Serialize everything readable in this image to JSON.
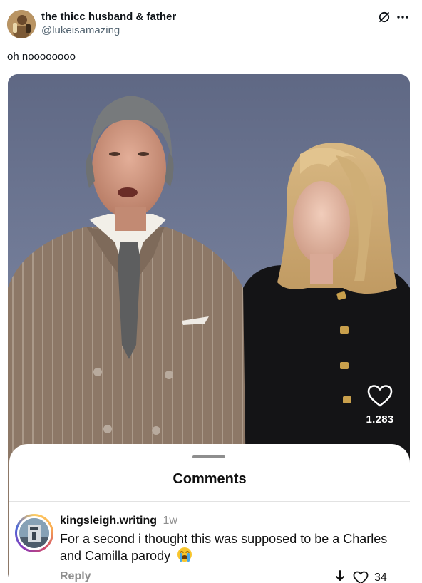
{
  "tweet": {
    "display_name": "the thicc husband & father",
    "handle": "@lukeisamazing",
    "text": "oh noooooooo",
    "icons": [
      "grok-icon",
      "more-icon"
    ]
  },
  "video": {
    "like_icon": "heart-outline-icon",
    "like_count": "1.283"
  },
  "comments_sheet": {
    "title": "Comments",
    "comment": {
      "username": "kingsleigh.writing",
      "time": "1w",
      "text": "For a second i thought this was supposed to be a Charles and Camilla parody",
      "emoji": "loudly-crying-face",
      "reply_label": "Reply",
      "like_count": "34",
      "icons": [
        "dislike-arrow-icon",
        "heart-outline-icon"
      ]
    }
  },
  "colors": {
    "text_primary": "#0f1419",
    "text_secondary": "#536471",
    "muted": "#8e8e8e",
    "backdrop": "#6f7894"
  }
}
